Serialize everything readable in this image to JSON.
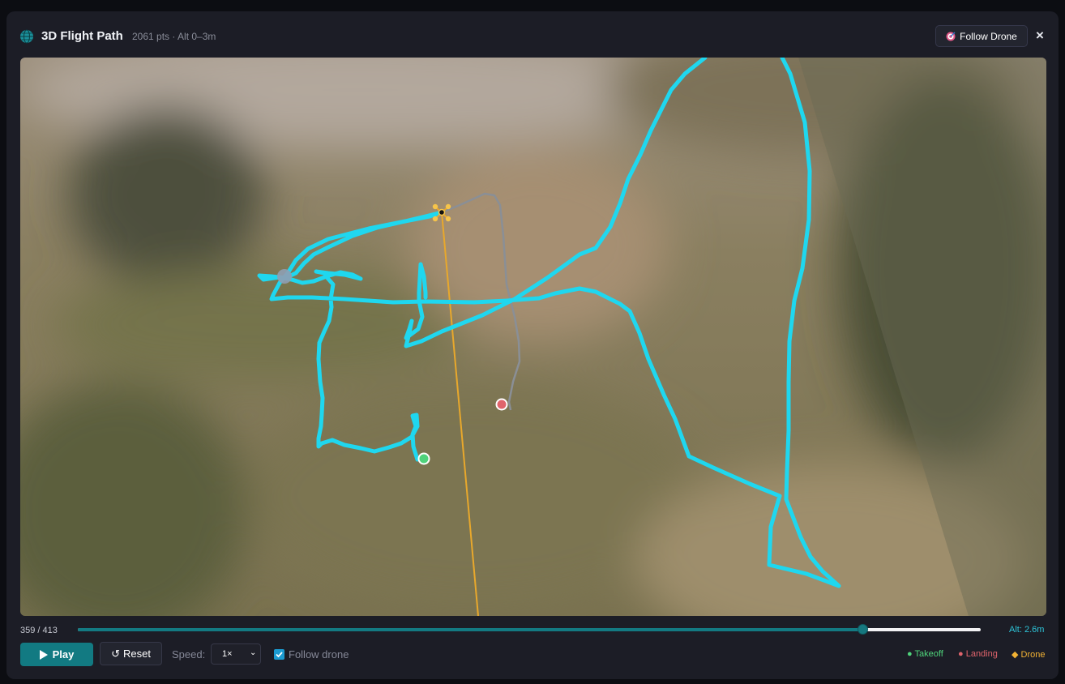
{
  "header": {
    "title": "3D Flight Path",
    "subtitle": "2061 pts · Alt 0–3m",
    "follow_button_label": "Follow Drone",
    "close_label": "×"
  },
  "playback": {
    "frame_text": "359 / 413",
    "progress_fraction": 0.869,
    "altitude_text": "Alt: 2.6m",
    "play_label": "Play",
    "reset_label": "Reset",
    "speed_label": "Speed:",
    "speed_value": "1×",
    "follow_checkbox_label": "Follow drone",
    "follow_checked": true
  },
  "legend": {
    "takeoff": "Takeoff",
    "landing": "Landing",
    "drone": "Drone"
  },
  "colors": {
    "path": "#1fd7ef",
    "path_future": "#8a8f96",
    "takeoff": "#4fd37b",
    "landing": "#e0646c",
    "drone": "#f2b234",
    "accent": "#137a82"
  },
  "icons": {
    "title": "globe-icon",
    "follow": "target-icon",
    "play": "play-icon",
    "reset": "reset-icon"
  }
}
